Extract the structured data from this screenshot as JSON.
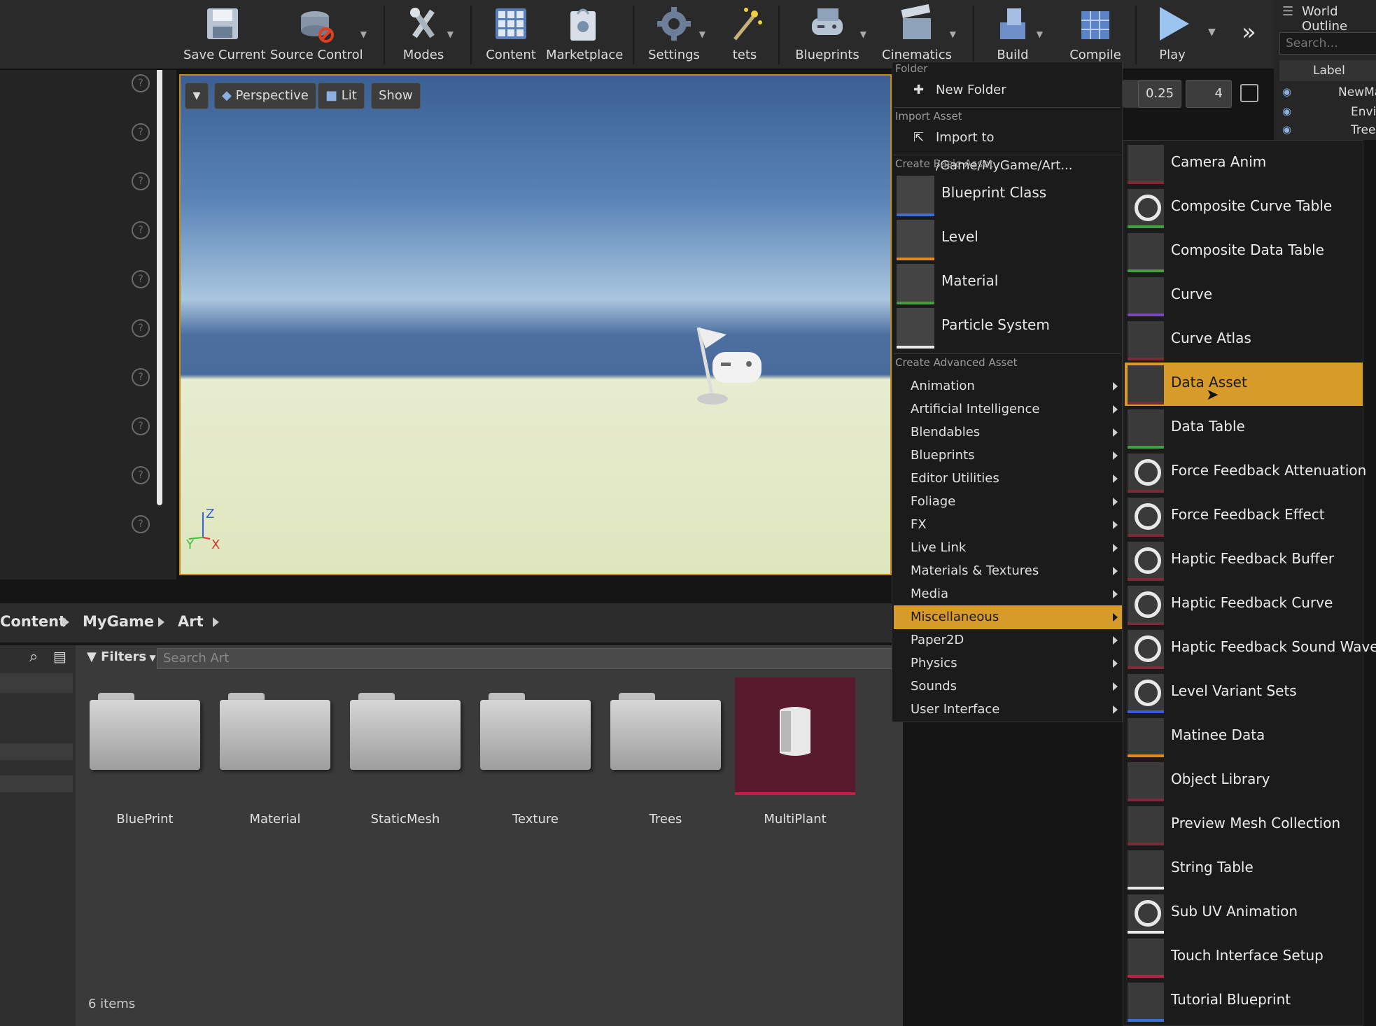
{
  "toolbar": {
    "save_current": "Save Current",
    "source_control": "Source Control",
    "modes": "Modes",
    "content": "Content",
    "marketplace": "Marketplace",
    "settings": "Settings",
    "tets": "tets",
    "blueprints": "Blueprints",
    "cinematics": "Cinematics",
    "build": "Build",
    "compile": "Compile",
    "play": "Play"
  },
  "viewport": {
    "perspective": "Perspective",
    "lit": "Lit",
    "show": "Show",
    "snap_value": "0.25",
    "camera_speed": "4",
    "axis_z": "Z",
    "axis_x": "X",
    "axis_y": "Y"
  },
  "outliner": {
    "title": "World Outline",
    "search_placeholder": "Search...",
    "col_label": "Label",
    "rows": [
      "NewMa",
      "Envir",
      "Tree"
    ]
  },
  "content_browser": {
    "breadcrumb": [
      "Content",
      "MyGame",
      "Art"
    ],
    "filters": "Filters",
    "search_placeholder": "Search Art",
    "items": [
      "BluePrint",
      "Material",
      "StaticMesh",
      "Texture",
      "Trees",
      "MultiPlant"
    ],
    "count": "6 items"
  },
  "menu": {
    "folder_header": "Folder",
    "new_folder": "New Folder",
    "import_header": "Import Asset",
    "import_to": "Import to /Game/MyGame/Art...",
    "basic_header": "Create Basic Asset",
    "basic": [
      "Blueprint Class",
      "Level",
      "Material",
      "Particle System"
    ],
    "advanced_header": "Create Advanced Asset",
    "advanced": [
      "Animation",
      "Artificial Intelligence",
      "Blendables",
      "Blueprints",
      "Editor Utilities",
      "Foliage",
      "FX",
      "Live Link",
      "Materials & Textures",
      "Media",
      "Miscellaneous",
      "Paper2D",
      "Physics",
      "Sounds",
      "User Interface"
    ],
    "selected_category": "Miscellaneous"
  },
  "submenu": {
    "items": [
      "Camera Anim",
      "Composite Curve Table",
      "Composite Data Table",
      "Curve",
      "Curve Atlas",
      "Data Asset",
      "Data Table",
      "Force Feedback Attenuation",
      "Force Feedback Effect",
      "Haptic Feedback Buffer",
      "Haptic Feedback Curve",
      "Haptic Feedback Sound Wave",
      "Level Variant Sets",
      "Matinee Data",
      "Object Library",
      "Preview Mesh Collection",
      "String Table",
      "Sub UV Animation",
      "Touch Interface Setup",
      "Tutorial Blueprint"
    ],
    "selected": "Data Asset"
  },
  "colors": {
    "accent": "#d79b2a",
    "multiplant": "#5a1a2e"
  }
}
